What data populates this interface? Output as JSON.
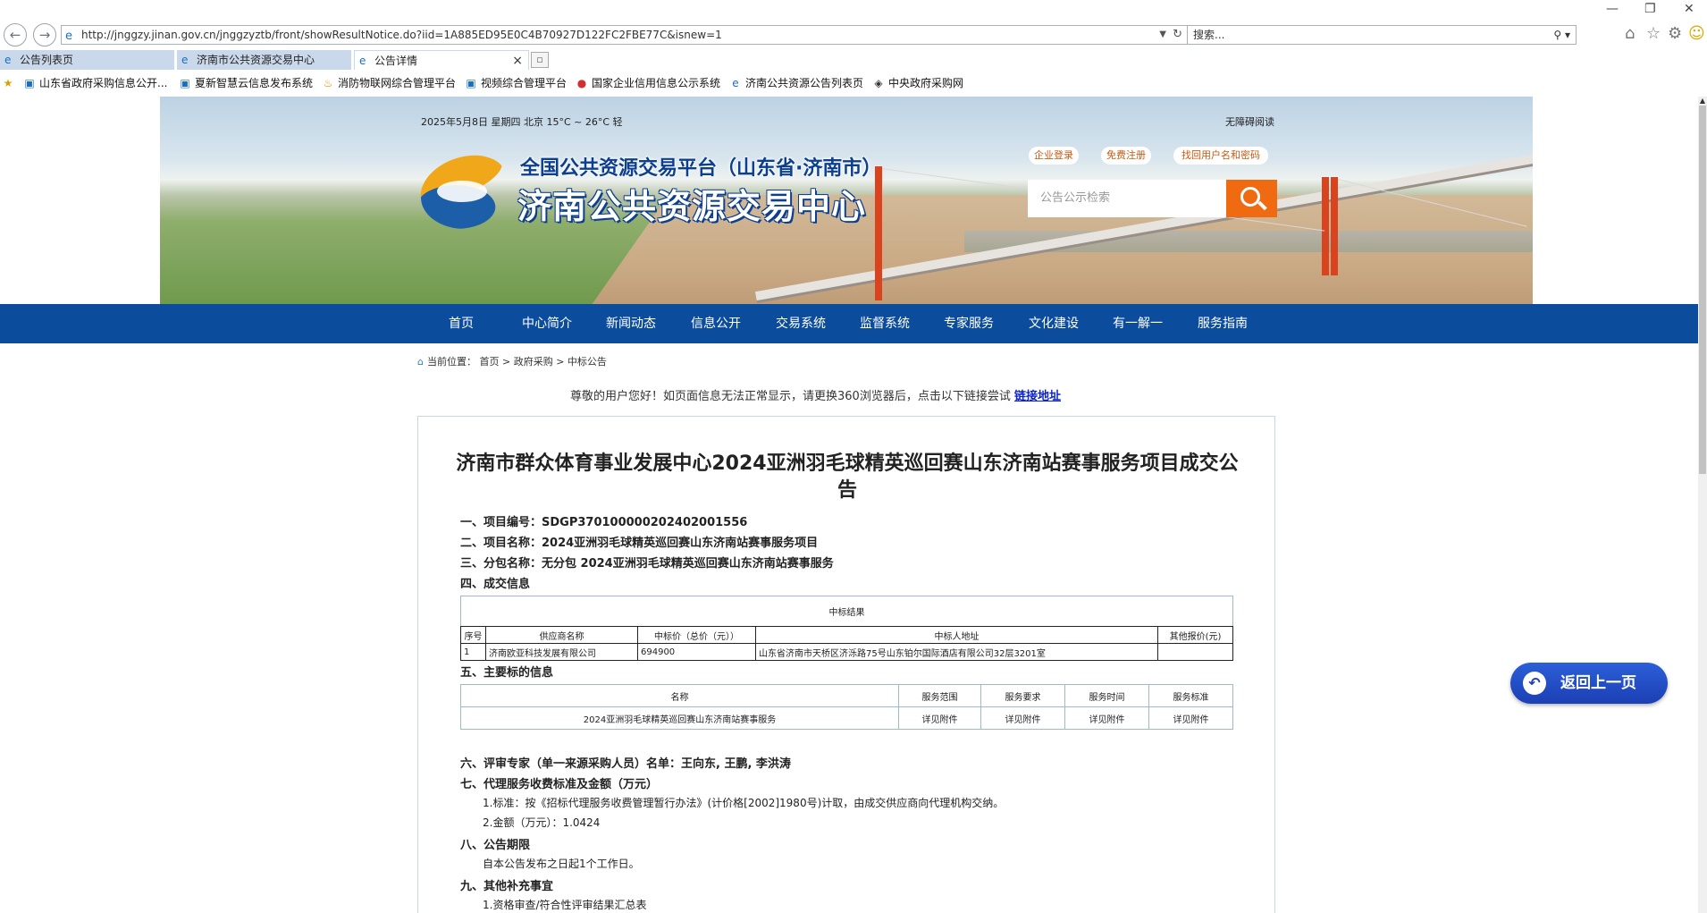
{
  "browser": {
    "url": "http://jnggzy.jinan.gov.cn/jnggzyztb/front/showResultNotice.do?iid=1A885ED95E0C4B70927D122FC2FBE77C&isnew=1",
    "search_placeholder": "搜索...",
    "tabs": [
      {
        "label": "公告列表页",
        "active": false
      },
      {
        "label": "济南市公共资源交易中心",
        "active": false
      },
      {
        "label": "公告详情",
        "active": true
      }
    ],
    "favorites": [
      "山东省政府采购信息公开...",
      "夏新智慧云信息发布系统",
      "消防物联网综合管理平台",
      "视频综合管理平台",
      "国家企业信用信息公示系统",
      "济南公共资源公告列表页",
      "中央政府采购网"
    ]
  },
  "header": {
    "date_line": "2025年5月8日 星期四  北京 15°C ~ 26°C 轻",
    "accessibility": "无障碍阅读",
    "platform_title": "全国公共资源交易平台（山东省·济南市）",
    "center_title": "济南公共资源交易中心",
    "links": [
      "企业登录",
      "免费注册",
      "找回用户名和密码"
    ],
    "search_placeholder": "公告公示检索"
  },
  "nav": [
    "首页",
    "中心简介",
    "新闻动态",
    "信息公开",
    "交易系统",
    "监督系统",
    "专家服务",
    "文化建设",
    "有一解一",
    "服务指南"
  ],
  "breadcrumb": {
    "prefix": "当前位置：",
    "path": "首页 > 政府采购 > 中标公告"
  },
  "notice": {
    "text": "尊敬的用户您好！如页面信息无法正常显示，请更换360浏览器后，点击以下链接尝试",
    "link": "链接地址"
  },
  "document": {
    "title": "济南市群众体育事业发展中心2024亚洲羽毛球精英巡回赛山东济南站赛事服务项目成交公告",
    "project_no": "一、项目编号：SDGP370100000202402001556",
    "project_name": "二、项目名称：2024亚洲羽毛球精英巡回赛山东济南站赛事服务项目",
    "package_name": "三、分包名称：无分包 2024亚洲羽毛球精英巡回赛山东济南站赛事服务",
    "deal_info_heading": "四、成交信息",
    "deal_table": {
      "caption": "中标结果",
      "headers": [
        "序号",
        "供应商名称",
        "中标价（总价（元））",
        "中标人地址",
        "其他报价(元)"
      ],
      "rows": [
        [
          "1",
          "济南欧亚科技发展有限公司",
          "694900",
          "山东省济南市天桥区济泺路75号山东铂尔国际酒店有限公司32层3201室",
          ""
        ]
      ]
    },
    "main_subject_heading": "五、主要标的信息",
    "subject_table": {
      "headers": [
        "名称",
        "服务范围",
        "服务要求",
        "服务时间",
        "服务标准"
      ],
      "rows": [
        [
          "2024亚洲羽毛球精英巡回赛山东济南站赛事服务",
          "详见附件",
          "详见附件",
          "详见附件",
          "详见附件"
        ]
      ]
    },
    "experts": "六、评审专家（单一来源采购人员）名单：王向东, 王鹏, 李洪涛",
    "agency_fee_heading": "七、代理服务收费标准及金额（万元）",
    "agency_fee_standard": "1.标准：按《招标代理服务收费管理暂行办法》(计价格[2002]1980号)计取，由成交供应商向代理机构交纳。",
    "agency_fee_amount": "2.金额（万元）：1.0424",
    "period_heading": "八、公告期限",
    "period_text": "自本公告发布之日起1个工作日。",
    "other_heading": "九、其他补充事宜",
    "other_text": "1.资格审查/符合性评审结果汇总表"
  },
  "back_button": "返回上一页",
  "colors": {
    "nav_blue": "#0b4c9d",
    "search_orange": "#f06a12",
    "link_blue": "#0b25c9",
    "back_button": "#1c3fb4"
  }
}
